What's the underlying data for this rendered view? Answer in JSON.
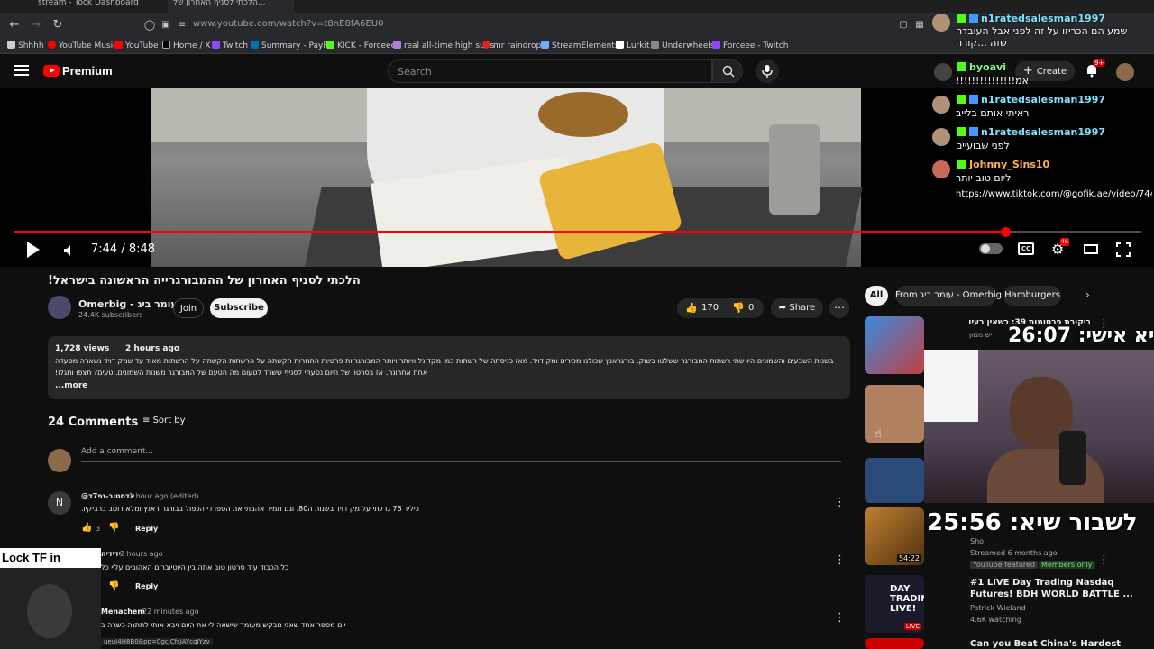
{
  "browser": {
    "tabs": [
      "stream - Tock Dashboard",
      "הלכתי לסניף האחרון של..."
    ],
    "url": "www.youtube.com/watch?v=t8nE8fA6EU0",
    "bookmarks": [
      "Shhhh",
      "YouTube Music",
      "YouTube",
      "Home / X",
      "Twitch",
      "Summary - PayPal",
      "KICK - Forceee",
      "real all-time high subs",
      "mr raindrop",
      "StreamElements -",
      "Lurkit",
      "Underwheels",
      "Forceee - Twitch"
    ]
  },
  "header": {
    "logo": "Premium",
    "search_placeholder": "Search",
    "create_label": "Create",
    "notif_count": "9+"
  },
  "player": {
    "time": "7:44 / 8:48",
    "progress": 0.879,
    "cc_label": "CC",
    "quality_badge": "4K"
  },
  "chat": [
    {
      "name": "n1ratedsalesman1997",
      "msg": "שמע הם הכריזו על זה לפני אבל העובדה שזה ...קורה"
    },
    {
      "name": "byoavi",
      "msg": "!!!!!!!!!!!!!!!אמ"
    },
    {
      "name": "n1ratedsalesman1997",
      "msg": "ראיתי אותם בלייב"
    },
    {
      "name": "n1ratedsalesman1997",
      "msg": "לפני שבועיים"
    },
    {
      "name": "Johnny_Sins10",
      "msg": "ליום טוב יותר"
    },
    {
      "name": "",
      "msg": "https://www.tiktok.com/@gofik.ae/video/7448"
    }
  ],
  "video": {
    "title": "הלכתי לסניף האחרון של ההמבורגרייה הראשונה בישראל!",
    "channel": "Omerbig - עומר ביג",
    "subscribers": "24.4K subscribers",
    "join_label": "Join",
    "subscribe_label": "Subscribe",
    "likes": "170",
    "dislikes": "0",
    "share_label": "Share",
    "views": "1,728 views",
    "age": "2 hours ago",
    "description_line1": "בשנות השבעים והשמונים היו שתי רשתות המבורגר ששלטו בשוק. בורגראנץ שכולנו מכירים ומק דויד. מאז כניסתה של רשתות כמו מקדונל וויותר ויותר המבורגריות פרטיות התחרות הקשתה על הרשתות הקשתה על הרשתות מאוד עד שמק דויד נשארה מסעדה",
    "description_line2": "אחת אחרונה. אז בסרטון של היום נסעתי לסניף ששרד לטעום מה הטעם של המבורגר משנות השמונים. טעים? תצפו ותגלו!",
    "more_label": "...more"
  },
  "comments": {
    "count_label": "24 Comments",
    "sort_label": "Sort by",
    "add_placeholder": "Add a comment...",
    "items": [
      {
        "author": "@אדסטוב-נפ7ד",
        "time": "1 hour ago (edited)",
        "text": "כיליד 76 גדלתי על מק דויד בשנות ה80. וגם תמיד אהבתי את הספרדי הכפול בבורגר ראנץ ומלא רוטב ברביקיו.",
        "likes": "3",
        "reply": "Reply"
      },
      {
        "author": "ידידיה",
        "time": "2 hours ago",
        "text": "כל הכבוד עוד סרטון טוב אתה בין היוטיוברים האהובים עליי כל",
        "likes": "",
        "reply": "Reply"
      },
      {
        "author": "Menachem",
        "time": "22 minutes ago",
        "text": "יום מספר אחד שאני מבקש מעומר שישאה לי את היום ויבא אותי לתתנה כשרה ב",
        "likes": "",
        "reply": "Reply"
      }
    ]
  },
  "filters": [
    "All",
    "From עומר ביג - Omerbig",
    "Hamburgers"
  ],
  "sidebar": [
    {
      "title": "ביקורת פרסומות 39: כשאין רעיון אבל",
      "meta1": "יש ממון",
      "meta2": "",
      "meta3": "",
      "duration": ""
    },
    {
      "title": "",
      "meta1": "",
      "meta2": "",
      "meta3": "",
      "duration": ""
    },
    {
      "title": "",
      "meta1": "",
      "meta2": "",
      "meta3": "",
      "duration": ""
    },
    {
      "title": "",
      "meta1": "Sho",
      "meta2": "Streamed 6 months ago",
      "meta3": "YouTube featured",
      "badge": "Members only",
      "duration": "54:22"
    },
    {
      "title": "#1 LIVE Day Trading Nasdaq",
      "title2": "Futures! BDH WORLD BATTLE ...",
      "meta1": "Patrick Wieland",
      "meta2": "4.6K watching",
      "live": "LIVE",
      "thumb_text": "DAY TRADING LIVE!"
    },
    {
      "title": "Can you Beat China's Hardest"
    }
  ],
  "stream_overlay": {
    "timer1": "שיא אישי: 26:07",
    "timer2": "לשבור שיא: 25:56",
    "cam_label": "Lock TF in",
    "link_text": "ueuI4H8B0&pp=0gcJCfsJAYcqIYzv"
  }
}
